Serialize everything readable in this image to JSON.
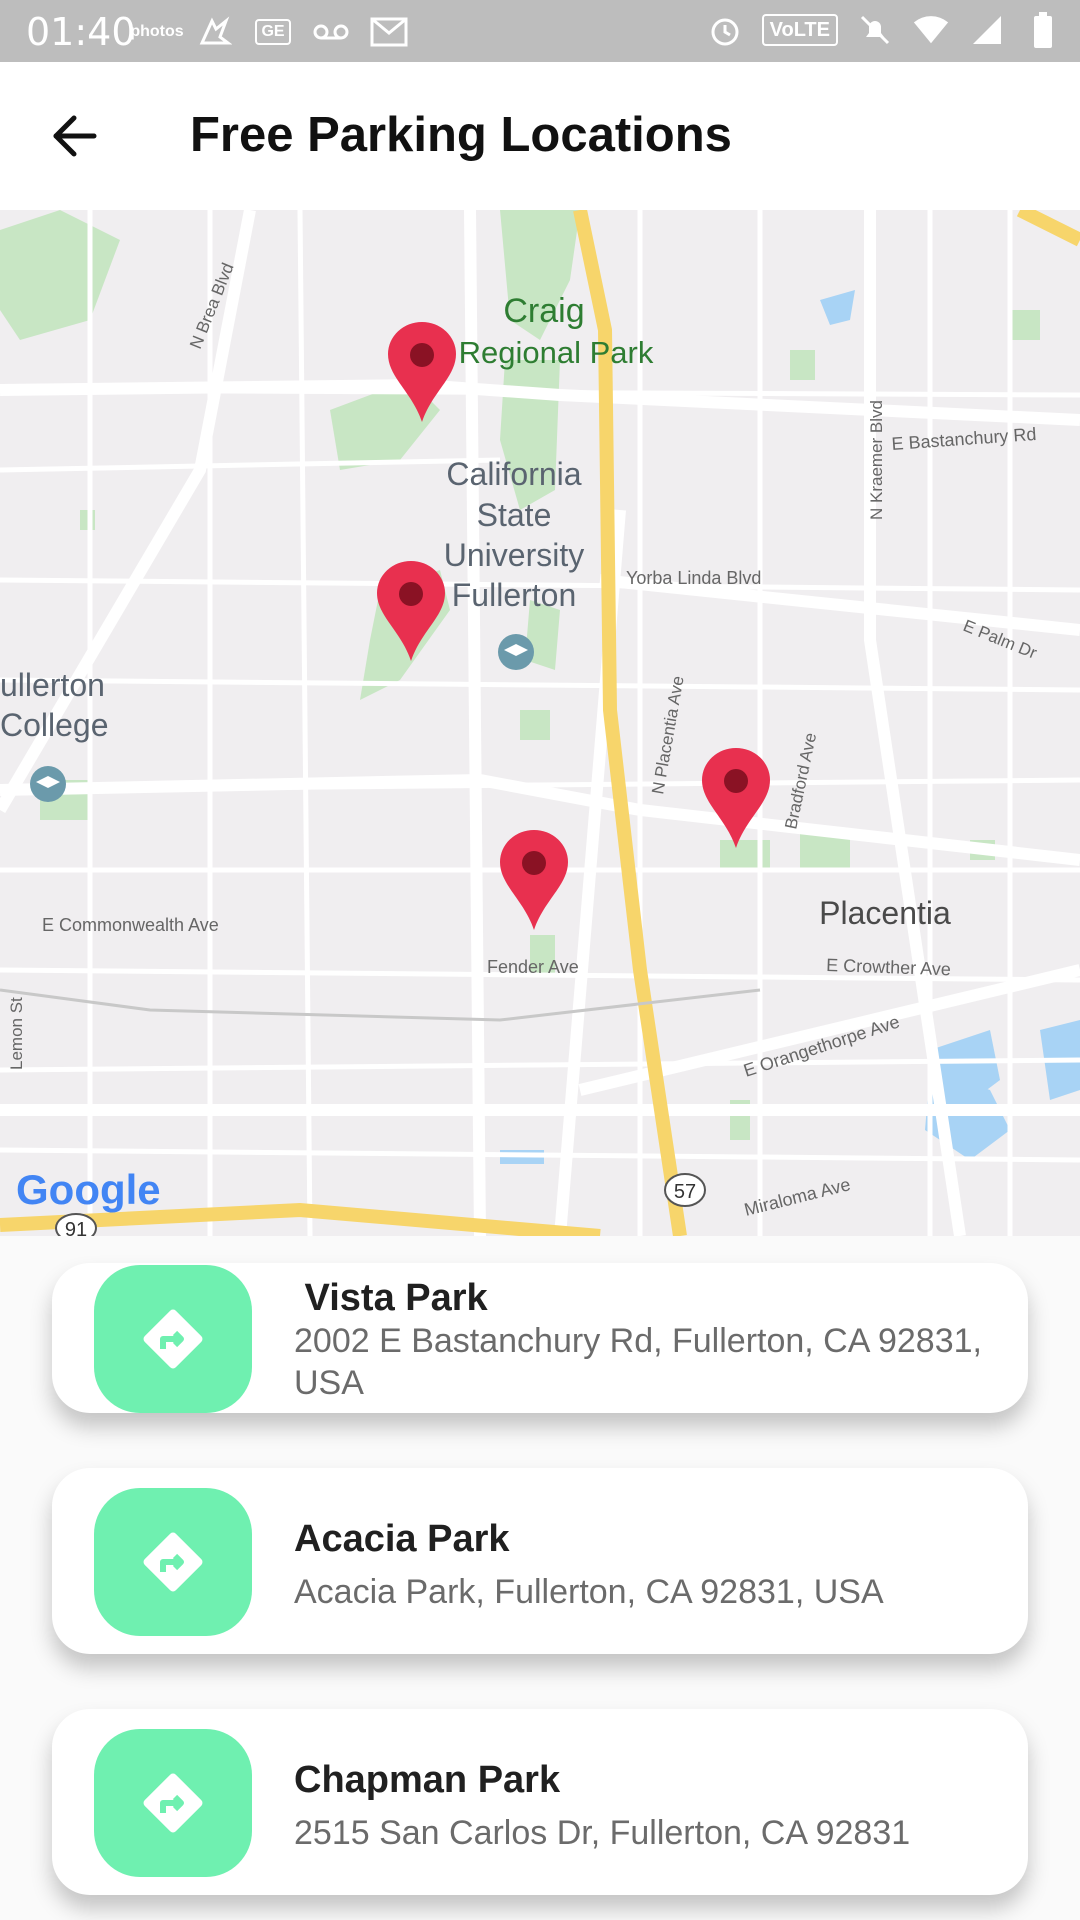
{
  "status_bar": {
    "time": "01:40",
    "left_icons": [
      "photos-icon",
      "app-icon",
      "ge-icon",
      "voicemail-icon",
      "gmail-icon"
    ],
    "right_icons": [
      "alarm-icon",
      "volte-icon",
      "mute-icon",
      "wifi-icon",
      "signal-icon",
      "battery-icon"
    ],
    "photos_label": "photos",
    "ge_label": "GE",
    "volte_label": "VoLTE"
  },
  "app_bar": {
    "title": "Free Parking Locations",
    "back_icon": "arrow-back-icon"
  },
  "map": {
    "labels": {
      "craig_1": "Craig",
      "craig_2": "Regional Park",
      "csu_1": "California",
      "csu_2": "State",
      "csu_3": "University",
      "csu_4": "Fullerton",
      "fullerton_college_1": "ullerton",
      "fullerton_college_2": "College",
      "placentia": "Placentia",
      "brea_blvd": "N Brea Blvd",
      "kraemer": "N Kraemer Blvd",
      "bastanchury": "E Bastanchury Rd",
      "yorba": "Yorba Linda Blvd",
      "palm": "E Palm Dr",
      "placentia_ave": "N Placentia Ave",
      "bradford": "Bradford Ave",
      "commonwealth": "E Commonwealth Ave",
      "fender": "Fender Ave",
      "crowther": "E Crowther Ave",
      "orangethorpe": "E Orangethorpe Ave",
      "lemon": "Lemon St",
      "miraloma": "Miraloma Ave",
      "hwy57": "57",
      "hwy91": "91",
      "google": "Google"
    },
    "colors": {
      "park": "#c8e6c4",
      "highway": "#f7d56b",
      "road": "#ffffff",
      "water": "#a8d3f5",
      "pin": "#e8304f"
    }
  },
  "parks": [
    {
      "name": " Vista Park",
      "address": "2002 E Bastanchury Rd, Fullerton, CA 92831, USA",
      "icon": "directions-icon"
    },
    {
      "name": "Acacia Park",
      "address": "Acacia Park, Fullerton, CA 92831, USA",
      "icon": "directions-icon"
    },
    {
      "name": "Chapman Park",
      "address": "2515 San Carlos Dr, Fullerton, CA 92831",
      "icon": "directions-icon"
    }
  ]
}
